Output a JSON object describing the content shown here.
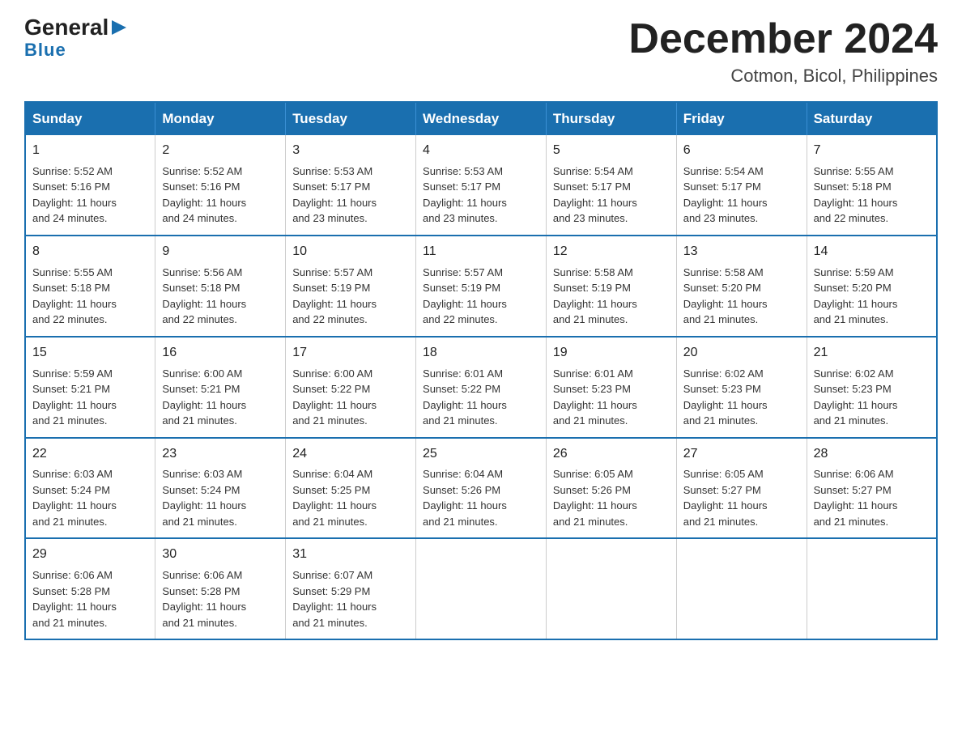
{
  "logo": {
    "general": "General",
    "arrow": "▶",
    "blue": "Blue"
  },
  "header": {
    "month": "December 2024",
    "location": "Cotmon, Bicol, Philippines"
  },
  "weekdays": [
    "Sunday",
    "Monday",
    "Tuesday",
    "Wednesday",
    "Thursday",
    "Friday",
    "Saturday"
  ],
  "weeks": [
    [
      {
        "day": "1",
        "sunrise": "5:52 AM",
        "sunset": "5:16 PM",
        "daylight": "11 hours and 24 minutes."
      },
      {
        "day": "2",
        "sunrise": "5:52 AM",
        "sunset": "5:16 PM",
        "daylight": "11 hours and 24 minutes."
      },
      {
        "day": "3",
        "sunrise": "5:53 AM",
        "sunset": "5:17 PM",
        "daylight": "11 hours and 23 minutes."
      },
      {
        "day": "4",
        "sunrise": "5:53 AM",
        "sunset": "5:17 PM",
        "daylight": "11 hours and 23 minutes."
      },
      {
        "day": "5",
        "sunrise": "5:54 AM",
        "sunset": "5:17 PM",
        "daylight": "11 hours and 23 minutes."
      },
      {
        "day": "6",
        "sunrise": "5:54 AM",
        "sunset": "5:17 PM",
        "daylight": "11 hours and 23 minutes."
      },
      {
        "day": "7",
        "sunrise": "5:55 AM",
        "sunset": "5:18 PM",
        "daylight": "11 hours and 22 minutes."
      }
    ],
    [
      {
        "day": "8",
        "sunrise": "5:55 AM",
        "sunset": "5:18 PM",
        "daylight": "11 hours and 22 minutes."
      },
      {
        "day": "9",
        "sunrise": "5:56 AM",
        "sunset": "5:18 PM",
        "daylight": "11 hours and 22 minutes."
      },
      {
        "day": "10",
        "sunrise": "5:57 AM",
        "sunset": "5:19 PM",
        "daylight": "11 hours and 22 minutes."
      },
      {
        "day": "11",
        "sunrise": "5:57 AM",
        "sunset": "5:19 PM",
        "daylight": "11 hours and 22 minutes."
      },
      {
        "day": "12",
        "sunrise": "5:58 AM",
        "sunset": "5:19 PM",
        "daylight": "11 hours and 21 minutes."
      },
      {
        "day": "13",
        "sunrise": "5:58 AM",
        "sunset": "5:20 PM",
        "daylight": "11 hours and 21 minutes."
      },
      {
        "day": "14",
        "sunrise": "5:59 AM",
        "sunset": "5:20 PM",
        "daylight": "11 hours and 21 minutes."
      }
    ],
    [
      {
        "day": "15",
        "sunrise": "5:59 AM",
        "sunset": "5:21 PM",
        "daylight": "11 hours and 21 minutes."
      },
      {
        "day": "16",
        "sunrise": "6:00 AM",
        "sunset": "5:21 PM",
        "daylight": "11 hours and 21 minutes."
      },
      {
        "day": "17",
        "sunrise": "6:00 AM",
        "sunset": "5:22 PM",
        "daylight": "11 hours and 21 minutes."
      },
      {
        "day": "18",
        "sunrise": "6:01 AM",
        "sunset": "5:22 PM",
        "daylight": "11 hours and 21 minutes."
      },
      {
        "day": "19",
        "sunrise": "6:01 AM",
        "sunset": "5:23 PM",
        "daylight": "11 hours and 21 minutes."
      },
      {
        "day": "20",
        "sunrise": "6:02 AM",
        "sunset": "5:23 PM",
        "daylight": "11 hours and 21 minutes."
      },
      {
        "day": "21",
        "sunrise": "6:02 AM",
        "sunset": "5:23 PM",
        "daylight": "11 hours and 21 minutes."
      }
    ],
    [
      {
        "day": "22",
        "sunrise": "6:03 AM",
        "sunset": "5:24 PM",
        "daylight": "11 hours and 21 minutes."
      },
      {
        "day": "23",
        "sunrise": "6:03 AM",
        "sunset": "5:24 PM",
        "daylight": "11 hours and 21 minutes."
      },
      {
        "day": "24",
        "sunrise": "6:04 AM",
        "sunset": "5:25 PM",
        "daylight": "11 hours and 21 minutes."
      },
      {
        "day": "25",
        "sunrise": "6:04 AM",
        "sunset": "5:26 PM",
        "daylight": "11 hours and 21 minutes."
      },
      {
        "day": "26",
        "sunrise": "6:05 AM",
        "sunset": "5:26 PM",
        "daylight": "11 hours and 21 minutes."
      },
      {
        "day": "27",
        "sunrise": "6:05 AM",
        "sunset": "5:27 PM",
        "daylight": "11 hours and 21 minutes."
      },
      {
        "day": "28",
        "sunrise": "6:06 AM",
        "sunset": "5:27 PM",
        "daylight": "11 hours and 21 minutes."
      }
    ],
    [
      {
        "day": "29",
        "sunrise": "6:06 AM",
        "sunset": "5:28 PM",
        "daylight": "11 hours and 21 minutes."
      },
      {
        "day": "30",
        "sunrise": "6:06 AM",
        "sunset": "5:28 PM",
        "daylight": "11 hours and 21 minutes."
      },
      {
        "day": "31",
        "sunrise": "6:07 AM",
        "sunset": "5:29 PM",
        "daylight": "11 hours and 21 minutes."
      },
      null,
      null,
      null,
      null
    ]
  ],
  "labels": {
    "sunrise": "Sunrise:",
    "sunset": "Sunset:",
    "daylight": "Daylight:"
  }
}
